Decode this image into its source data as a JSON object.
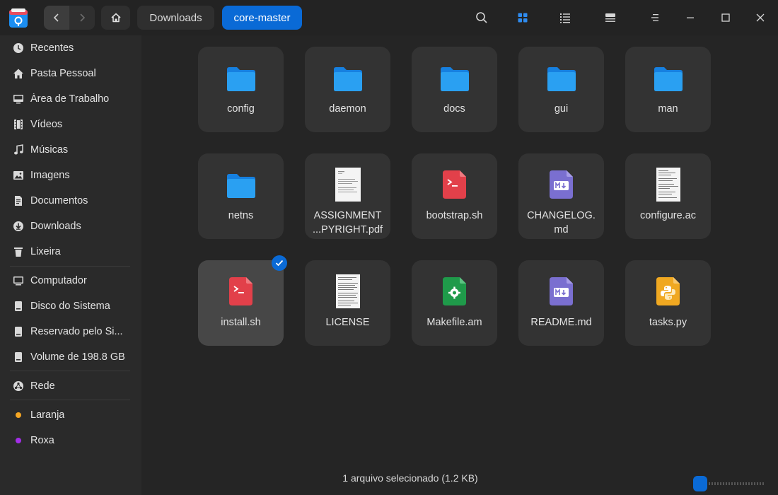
{
  "breadcrumbs": [
    {
      "label": "Downloads"
    },
    {
      "label": "core-master"
    }
  ],
  "icons": {
    "back": "chevron-left-icon",
    "forward": "chevron-right-icon",
    "home": "home-icon",
    "search": "search-icon",
    "grid_view": "grid-view-icon",
    "list_view": "list-view-icon",
    "tree_view": "tree-view-icon",
    "menu": "menu-icon",
    "minimize": "minimize-icon",
    "maximize": "maximize-icon",
    "close": "close-icon"
  },
  "active_view": "grid",
  "sidebar": {
    "items": [
      {
        "label": "Recentes",
        "icon": "clock-icon"
      },
      {
        "label": "Pasta Pessoal",
        "icon": "home-icon"
      },
      {
        "label": "Área de Trabalho",
        "icon": "desktop-icon"
      },
      {
        "label": "Vídeos",
        "icon": "film-icon"
      },
      {
        "label": "Músicas",
        "icon": "music-icon"
      },
      {
        "label": "Imagens",
        "icon": "image-icon"
      },
      {
        "label": "Documentos",
        "icon": "document-icon"
      },
      {
        "label": "Downloads",
        "icon": "download-icon"
      },
      {
        "label": "Lixeira",
        "icon": "trash-icon"
      },
      {
        "label": "Computador",
        "icon": "computer-icon"
      },
      {
        "label": "Disco do Sistema",
        "icon": "disk-icon"
      },
      {
        "label": "Reservado pelo Si...",
        "icon": "disk-icon"
      },
      {
        "label": "Volume de 198.8 GB",
        "icon": "disk-icon"
      },
      {
        "label": "Rede",
        "icon": "network-icon"
      },
      {
        "label": "Laranja",
        "icon": "tag-dot-icon",
        "color": "#f5a623"
      },
      {
        "label": "Roxa",
        "icon": "tag-dot-icon",
        "color": "#a32ee8"
      }
    ]
  },
  "files": [
    {
      "name": "config",
      "type": "folder"
    },
    {
      "name": "daemon",
      "type": "folder"
    },
    {
      "name": "docs",
      "type": "folder"
    },
    {
      "name": "gui",
      "type": "folder"
    },
    {
      "name": "man",
      "type": "folder"
    },
    {
      "name": "netns",
      "type": "folder"
    },
    {
      "name": "ASSIGNMENT",
      "name2": "...PYRIGHT.pdf",
      "type": "pdf"
    },
    {
      "name": "bootstrap.sh",
      "type": "shell"
    },
    {
      "name": "CHANGELOG.",
      "name2": "md",
      "type": "markdown"
    },
    {
      "name": "configure.ac",
      "type": "text"
    },
    {
      "name": "install.sh",
      "type": "shell",
      "selected": true
    },
    {
      "name": "LICENSE",
      "type": "text"
    },
    {
      "name": "Makefile.am",
      "type": "makefile"
    },
    {
      "name": "README.md",
      "type": "markdown"
    },
    {
      "name": "tasks.py",
      "type": "python"
    }
  ],
  "status": {
    "text": "1 arquivo selecionado (1.2 KB)"
  },
  "colors": {
    "accent": "#0a6ad6",
    "folder": "#2aa0f2",
    "shell": "#e2404a",
    "markdown": "#7a6fd0",
    "makefile": "#1f9a4a",
    "python": "#f0a821"
  }
}
